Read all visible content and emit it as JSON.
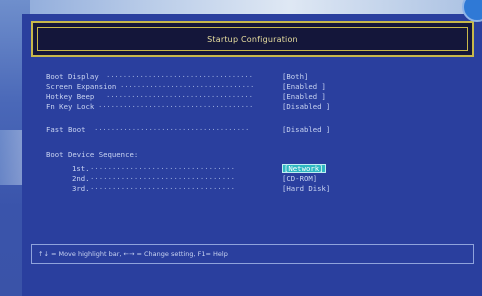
{
  "title": "Startup Configuration",
  "settings": [
    {
      "label": "Boot Display",
      "value": "[Both]"
    },
    {
      "label": "Screen Expansion",
      "value": "[Enabled ]"
    },
    {
      "label": "Hotkey Beep",
      "value": "[Enabled ]"
    },
    {
      "label": "Fn Key Lock",
      "value": "[Disabled ]"
    }
  ],
  "fast_boot": {
    "label": "Fast Boot",
    "value": "[Disabled ]"
  },
  "boot_sequence": {
    "heading": "Boot Device Sequence:",
    "items": [
      {
        "label": "1st.",
        "value": "[Network]"
      },
      {
        "label": "2nd.",
        "value": "[CD-ROM]"
      },
      {
        "label": "3rd.",
        "value": "[Hard Disk]"
      }
    ]
  },
  "help_text": "↑↓ = Move highlight bar,  ←→ = Change setting,  F1= Help",
  "colors": {
    "background": "#2a3f9e",
    "title_border": "#c8b84a",
    "highlight": "#2fb8c2"
  }
}
